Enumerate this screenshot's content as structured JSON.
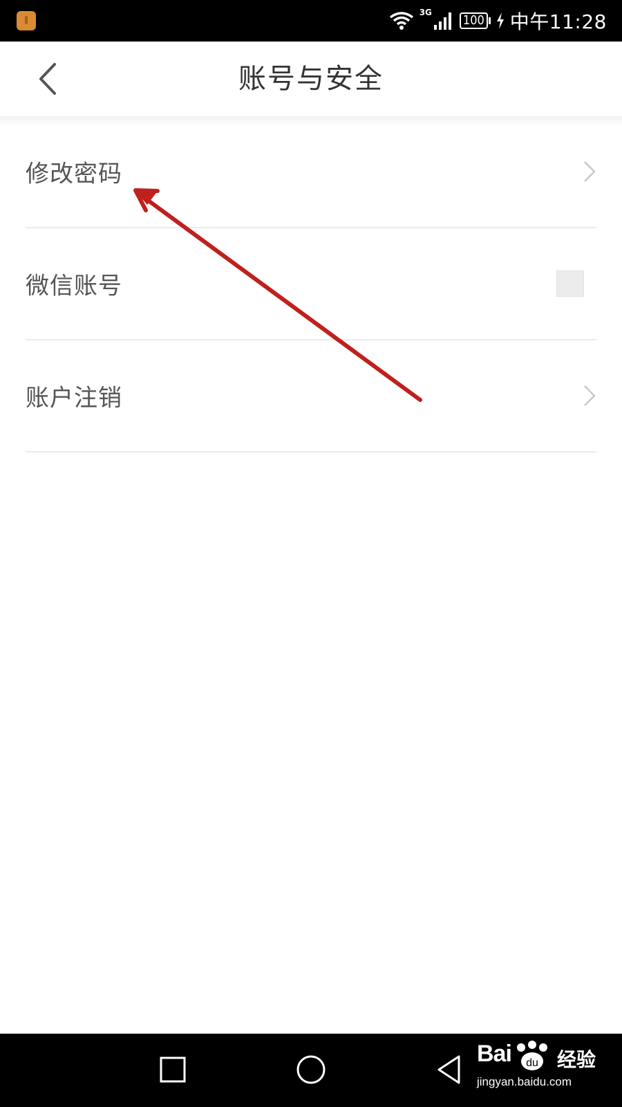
{
  "status_bar": {
    "network_type": "3G",
    "battery_level": "100",
    "time": "中午11:28",
    "icons": [
      "app-notification-icon",
      "wifi-icon",
      "signal-icon",
      "battery-icon",
      "charging-icon"
    ]
  },
  "header": {
    "title": "账号与安全",
    "back_icon": "chevron-left-icon"
  },
  "settings": {
    "items": [
      {
        "label": "修改密码",
        "accessory": "chevron-right-icon"
      },
      {
        "label": "微信账号",
        "accessory": "toggle-square"
      },
      {
        "label": "账户注销",
        "accessory": "chevron-right-icon"
      }
    ]
  },
  "nav_bar": {
    "icons": [
      "recent-apps-icon",
      "home-icon",
      "back-triangle-icon"
    ]
  },
  "watermark": {
    "logo": "Bai",
    "cn": "经验",
    "url": "jingyan.baidu.com"
  },
  "colors": {
    "status_bar_bg": "#000000",
    "title_text": "#333333",
    "row_text": "#555555",
    "divider": "#ebebeb",
    "annotation_arrow": "#c0201c"
  }
}
